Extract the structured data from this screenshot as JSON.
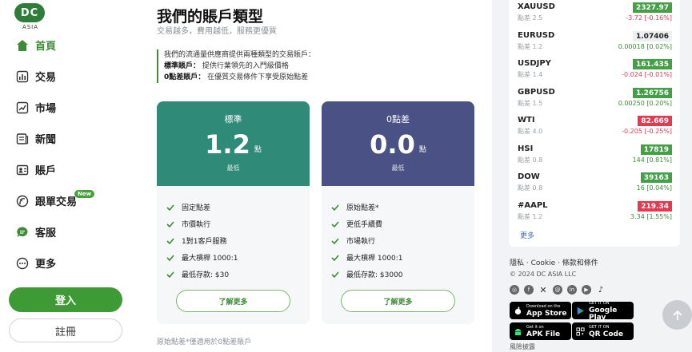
{
  "logo": {
    "text": "DC",
    "sub": "ASIA"
  },
  "nav": [
    {
      "label": "首頁",
      "icon": "home-icon"
    },
    {
      "label": "交易",
      "icon": "trade-icon"
    },
    {
      "label": "市場",
      "icon": "market-icon"
    },
    {
      "label": "新聞",
      "icon": "news-icon"
    },
    {
      "label": "賬戶",
      "icon": "account-icon"
    },
    {
      "label": "跟單交易",
      "icon": "copy-trading-icon",
      "badge": "New"
    },
    {
      "label": "客服",
      "icon": "support-icon"
    },
    {
      "label": "更多",
      "icon": "more-icon"
    }
  ],
  "auth": {
    "login": "登入",
    "register": "註冊"
  },
  "main": {
    "title": "我們的賬戶類型",
    "subtitle": "交易越多，費用越低，服務更優質",
    "desc_intro": "我們的流通量供應商提供兩種類型的交易賬戶：",
    "desc_standard_label": "標準賬戶：",
    "desc_standard_text": "提供行業領先的入門級價格",
    "desc_zero_label": "0點差賬戶：",
    "desc_zero_text": "在優質交易條件下享受原始點差",
    "footnote": "原始點差*僅適用於0點差賬戶"
  },
  "cards": [
    {
      "name": "標準",
      "value": "1.2",
      "unit": "點",
      "min_label": "最低",
      "features": [
        "固定點差",
        "市價執行",
        "1對1客戶服務",
        "最大槓桿 1000:1",
        "最低存款: $30"
      ],
      "button": "了解更多"
    },
    {
      "name": "0點差",
      "value": "0.0",
      "unit": "點",
      "min_label": "最低",
      "features": [
        "原始點差*",
        "更低手續費",
        "市場執行",
        "最大槓桿 1000:1",
        "最低存款: $3000"
      ],
      "button": "了解更多"
    }
  ],
  "market": {
    "rows": [
      {
        "symbol": "XAUUSD",
        "spread": "點差 2.5",
        "price": "2327.97",
        "change": "-3.72 [-0.16%]",
        "dir": "up"
      },
      {
        "symbol": "EURUSD",
        "spread": "點差 1.2",
        "price": "1.07406",
        "change": "0.00018 [0.02%]",
        "dir": "flat"
      },
      {
        "symbol": "USDJPY",
        "spread": "點差 1.4",
        "price": "161.435",
        "change": "-0.024 [-0.01%]",
        "dir": "up"
      },
      {
        "symbol": "GBPUSD",
        "spread": "點差 1.5",
        "price": "1.26756",
        "change": "0.00250 [0.20%]",
        "dir": "up"
      },
      {
        "symbol": "WTI",
        "spread": "點差 4.0",
        "price": "82.669",
        "change": "-0.205 [-0.25%]",
        "dir": "down"
      },
      {
        "symbol": "HSI",
        "spread": "點差 0.8",
        "price": "17819",
        "change": "144 [0.81%]",
        "dir": "up"
      },
      {
        "symbol": "DOW",
        "spread": "點差 0.8",
        "price": "39163",
        "change": "16 [0.04%]",
        "dir": "up"
      },
      {
        "symbol": "#AAPL",
        "spread": "點差 1.2",
        "price": "219.34",
        "change": "3.34 [1.55%]",
        "dir": "down"
      }
    ],
    "more": "更多"
  },
  "footer": {
    "links": "隱私 · Cookie · 條款和條件",
    "copyright": "© 2024 DC ASIA LLC",
    "socials": [
      "instagram-icon",
      "facebook-icon",
      "x-icon",
      "threads-icon",
      "linkedin-icon",
      "youtube-icon",
      "tiktok-icon"
    ],
    "stores": [
      {
        "small": "Download on the",
        "big": "App Store",
        "icon": "apple-icon"
      },
      {
        "small": "GET IT ON",
        "big": "Google Play",
        "icon": "google-play-icon"
      },
      {
        "small": "Get it on",
        "big": "APK File",
        "icon": "android-icon"
      },
      {
        "small": "GET IT ON",
        "big": "QR Code",
        "icon": "qr-code-icon"
      }
    ],
    "risk": "風險披露"
  },
  "colors": {
    "brand": "#3e9a35",
    "standard": "#2f8a78",
    "zero": "#4a5185",
    "up": "#43a047",
    "down": "#e53950"
  }
}
